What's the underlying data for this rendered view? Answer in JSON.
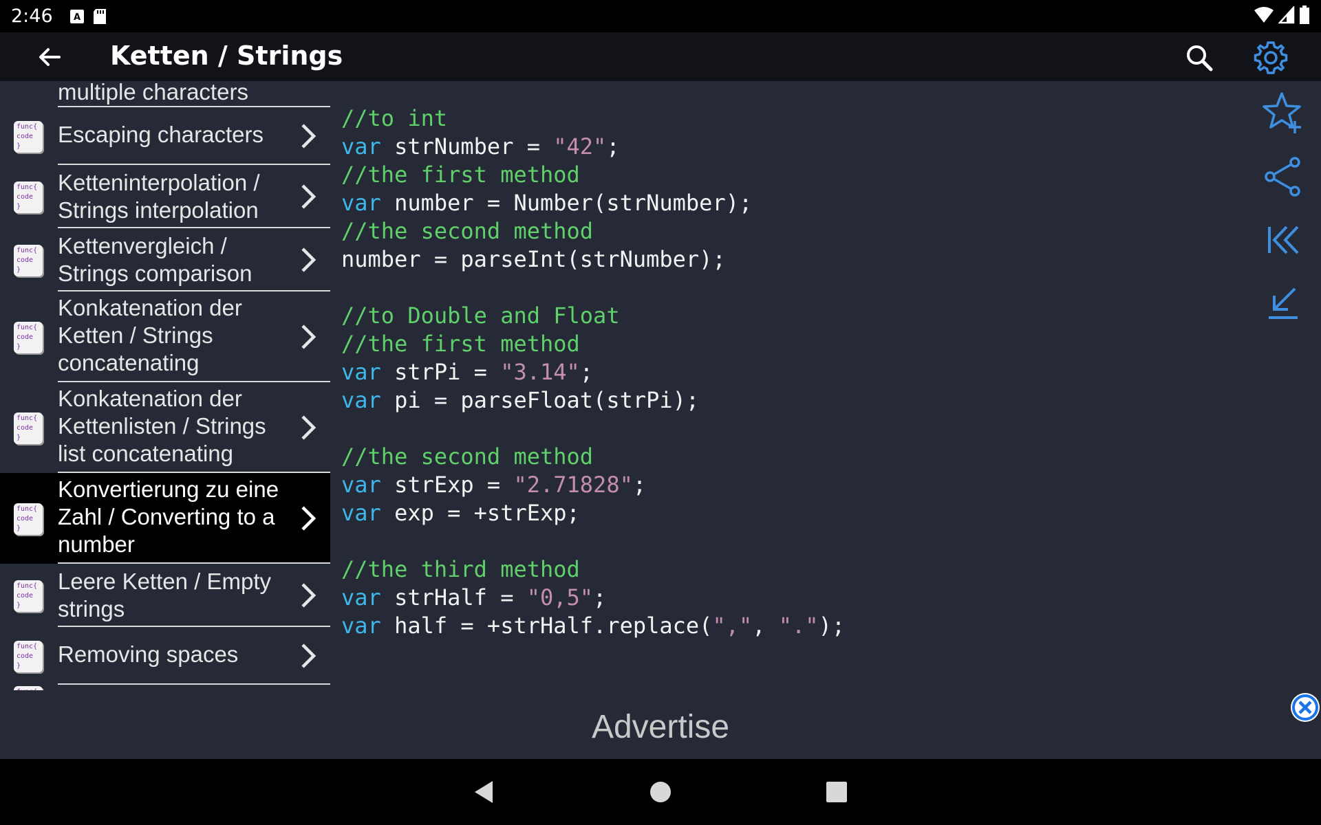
{
  "status": {
    "time": "2:46"
  },
  "appbar": {
    "title": "Ketten / Strings"
  },
  "sidebar": {
    "partial_top": "multiple characters",
    "items": [
      {
        "label": "Escaping characters"
      },
      {
        "label": "Ketteninterpolation / Strings interpolation"
      },
      {
        "label": "Kettenvergleich / Strings comparison"
      },
      {
        "label": "Konkatenation der Ketten / Strings concatenating"
      },
      {
        "label": "Konkatenation der Kettenlisten / Strings list concatenating"
      },
      {
        "label": "Konvertierung zu eine Zahl / Converting to a number"
      },
      {
        "label": "Leere Ketten / Empty strings"
      },
      {
        "label": "Removing spaces"
      }
    ],
    "icon_text": {
      "line1": "func{",
      "line2": "code",
      "line3": "}"
    }
  },
  "code": {
    "l1": "//to int",
    "l2_kw": "var",
    "l2_a": " strNumber = ",
    "l2_s": "\"42\"",
    "l2_b": ";",
    "l3": "//the first method",
    "l4_kw": "var",
    "l4_a": " number = Number(strNumber);",
    "l5": "//the second method",
    "l6": "number = parseInt(strNumber);",
    "l8": "//to Double and Float",
    "l9": "//the first method",
    "l10_kw": "var",
    "l10_a": " strPi = ",
    "l10_s": "\"3.14\"",
    "l10_b": ";",
    "l11_kw": "var",
    "l11_a": " pi = parseFloat(strPi);",
    "l13": "//the second method",
    "l14_kw": "var",
    "l14_a": " strExp = ",
    "l14_s": "\"2.71828\"",
    "l14_b": ";",
    "l15_kw": "var",
    "l15_a": " exp = +strExp;",
    "l17": "//the third method",
    "l18_kw": "var",
    "l18_a": " strHalf = ",
    "l18_s": "\"0,5\"",
    "l18_b": ";",
    "l19_kw": "var",
    "l19_a": " half = +strHalf.replace(",
    "l19_s1": "\",\"",
    "l19_c": ", ",
    "l19_s2": "\".\"",
    "l19_b": ");"
  },
  "ad": {
    "text": "Advertise"
  },
  "colors": {
    "accent": "#3f8fe0",
    "keyword": "#3fb6ea",
    "comment": "#5fd06a",
    "string": "#c48fa8"
  }
}
